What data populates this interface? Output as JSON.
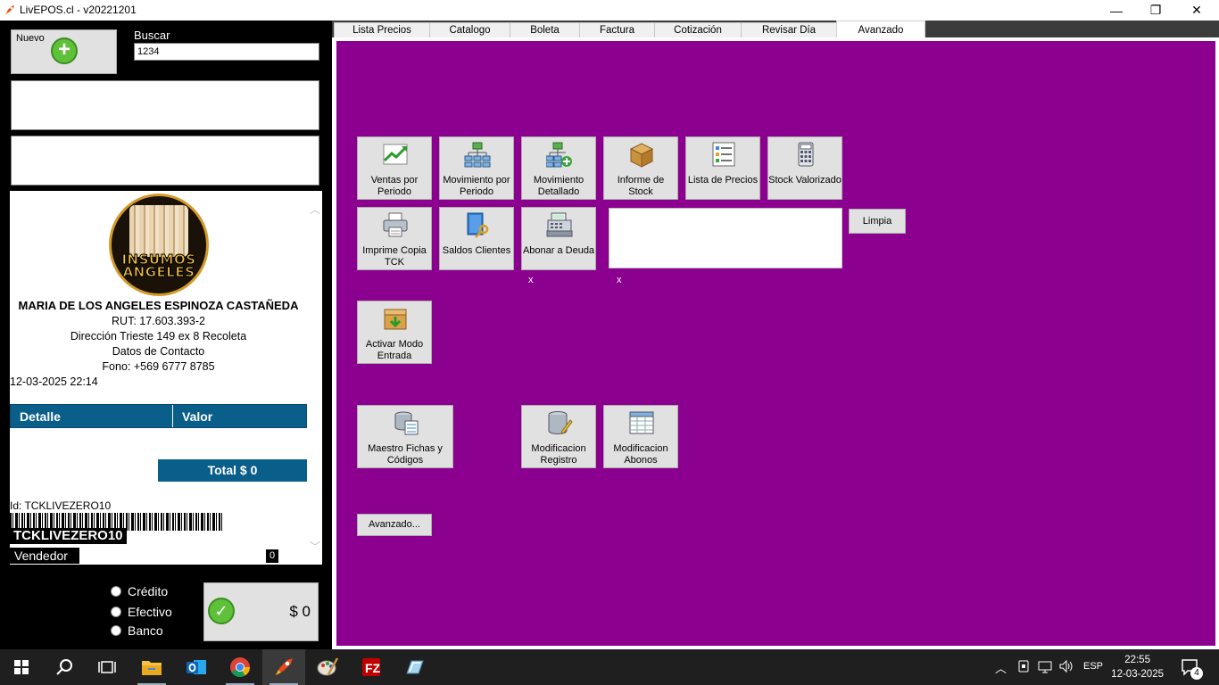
{
  "window": {
    "title": "LivEPOS.cl - v20221201"
  },
  "left": {
    "nuevo_label": "Nuevo",
    "buscar_label": "Buscar",
    "buscar_value": "1234",
    "ticket": {
      "name": "MARIA DE LOS ANGELES ESPINOZA CASTAÑEDA",
      "rut": "RUT: 17.603.393-2",
      "direccion": "Dirección Trieste 149 ex 8 Recoleta",
      "datos": "Datos de Contacto",
      "fono": "Fono: +569 6777 8785",
      "datetime": "12-03-2025 22:14",
      "col_detalle": "Detalle",
      "col_valor": "Valor",
      "total": "Total $ 0",
      "id_line": "Id: TCKLIVEZERO10",
      "ticket_code": "TCKLIVEZERO10",
      "vendedor": "Vendedor",
      "vendedor_count": "0",
      "logo_text_1": "INSUMOS",
      "logo_text_2": "ANGELES"
    },
    "payment_options": [
      "Crédito",
      "Efectivo",
      "Banco"
    ],
    "pay_amount": "$ 0"
  },
  "tabs": [
    "Lista Precios",
    "Catalogo",
    "Boleta",
    "Factura",
    "Cotización",
    "Revisar Día",
    "Avanzado"
  ],
  "active_tab": "Avanzado",
  "tiles_row1": [
    {
      "label": "Ventas por Periodo",
      "icon": "chart-up-icon"
    },
    {
      "label": "Movimiento por Periodo",
      "icon": "org-chart-icon"
    },
    {
      "label": "Movimiento Detallado",
      "icon": "org-chart-add-icon"
    },
    {
      "label": "Informe de Stock",
      "icon": "box-icon"
    },
    {
      "label": "Lista de Precios",
      "icon": "list-icon"
    },
    {
      "label": "Stock Valorizado",
      "icon": "calculator-icon"
    }
  ],
  "tiles_row2": [
    {
      "label": "Imprime Copia TCK",
      "icon": "printer-icon"
    },
    {
      "label": "Saldos Clientes",
      "icon": "book-key-icon"
    },
    {
      "label": "Abonar a Deuda",
      "icon": "cash-register-icon"
    }
  ],
  "limpia_label": "Limpia",
  "x_marks": [
    "x",
    "x"
  ],
  "activar_label": "Activar Modo Entrada",
  "tiles_row4": [
    {
      "label": "Maestro Fichas y Códigos",
      "icon": "database-records-icon"
    },
    {
      "label": "Modificacion Registro",
      "icon": "database-edit-icon"
    },
    {
      "label": "Modificacion Abonos",
      "icon": "spreadsheet-icon"
    }
  ],
  "avanzado_label": "Avanzado...",
  "taskbar": {
    "lang": "ESP",
    "time": "22:55",
    "date": "12-03-2025",
    "notifications": "4"
  },
  "colors": {
    "panel_purple": "#8c0090",
    "ticket_header": "#0a5e8a",
    "accent_green": "#5fc03a"
  }
}
